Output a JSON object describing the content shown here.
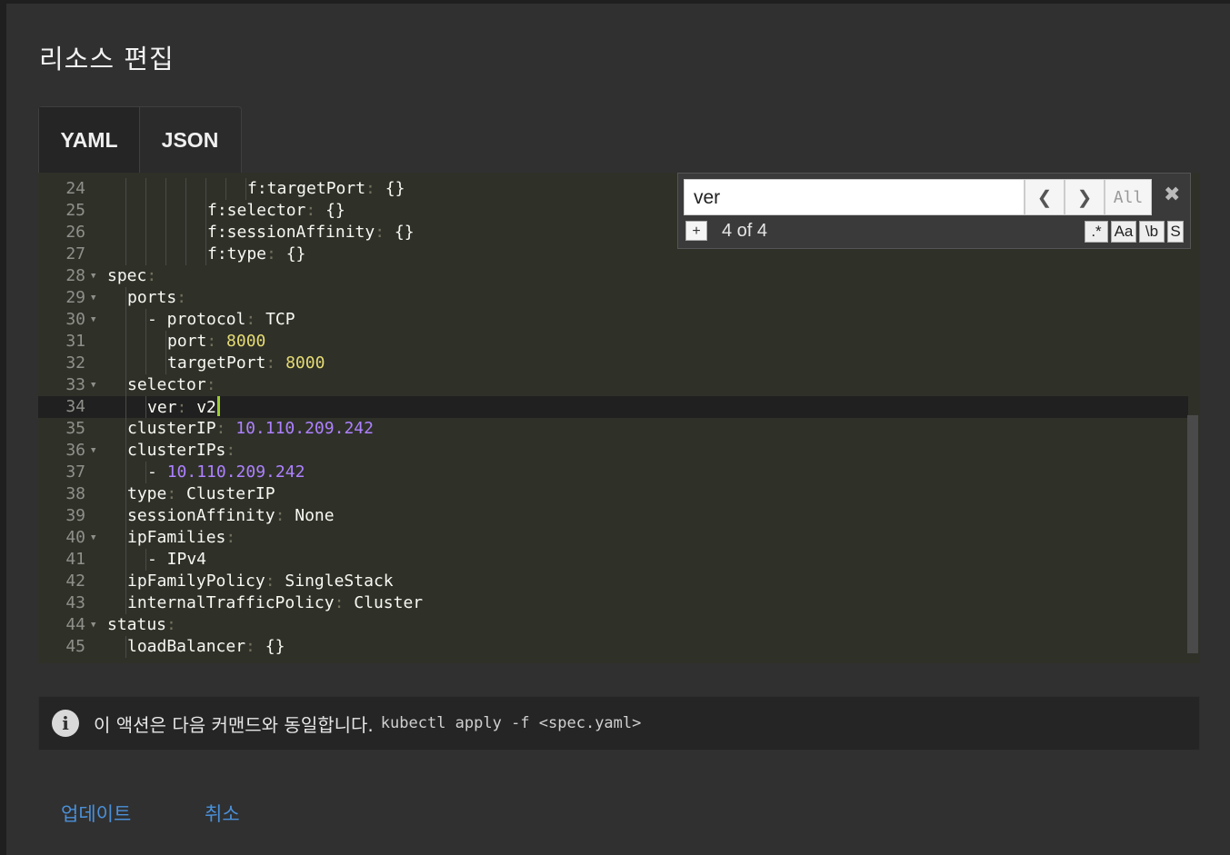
{
  "dialog": {
    "title": "리소스 편집",
    "tabs": [
      "YAML",
      "JSON"
    ],
    "active_tab": "YAML"
  },
  "editor": {
    "lines": [
      {
        "n": "24",
        "indent": 7,
        "parts": [
          [
            "k",
            "f:targetPort"
          ],
          [
            "p",
            ": "
          ],
          [
            "k",
            "{}"
          ]
        ]
      },
      {
        "n": "25",
        "indent": 5,
        "parts": [
          [
            "k",
            "f:selector"
          ],
          [
            "p",
            ": "
          ],
          [
            "k",
            "{}"
          ]
        ]
      },
      {
        "n": "26",
        "indent": 5,
        "parts": [
          [
            "k",
            "f:sessionAffinity"
          ],
          [
            "p",
            ": "
          ],
          [
            "k",
            "{}"
          ]
        ]
      },
      {
        "n": "27",
        "indent": 5,
        "parts": [
          [
            "k",
            "f:type"
          ],
          [
            "p",
            ": "
          ],
          [
            "k",
            "{}"
          ]
        ]
      },
      {
        "n": "28",
        "indent": 0,
        "fold": true,
        "parts": [
          [
            "k",
            "spec"
          ],
          [
            "p",
            ":"
          ]
        ]
      },
      {
        "n": "29",
        "indent": 1,
        "fold": true,
        "parts": [
          [
            "k",
            "ports"
          ],
          [
            "p",
            ":"
          ]
        ]
      },
      {
        "n": "30",
        "indent": 2,
        "fold": true,
        "parts": [
          [
            "k",
            "- protocol"
          ],
          [
            "p",
            ": "
          ],
          [
            "k",
            "TCP"
          ]
        ]
      },
      {
        "n": "31",
        "indent": 3,
        "parts": [
          [
            "k",
            "port"
          ],
          [
            "p",
            ": "
          ],
          [
            "s",
            "8000"
          ]
        ]
      },
      {
        "n": "32",
        "indent": 3,
        "parts": [
          [
            "k",
            "targetPort"
          ],
          [
            "p",
            ": "
          ],
          [
            "s",
            "8000"
          ]
        ]
      },
      {
        "n": "33",
        "indent": 1,
        "fold": true,
        "parts": [
          [
            "k",
            "selector"
          ],
          [
            "p",
            ":"
          ]
        ]
      },
      {
        "n": "34",
        "indent": 2,
        "active": true,
        "parts": [
          [
            "k",
            "ver"
          ],
          [
            "p",
            ": "
          ],
          [
            "k",
            "v2"
          ]
        ]
      },
      {
        "n": "35",
        "indent": 1,
        "parts": [
          [
            "k",
            "clusterIP"
          ],
          [
            "p",
            ": "
          ],
          [
            "n",
            "10.110.209.242"
          ]
        ]
      },
      {
        "n": "36",
        "indent": 1,
        "fold": true,
        "parts": [
          [
            "k",
            "clusterIPs"
          ],
          [
            "p",
            ":"
          ]
        ]
      },
      {
        "n": "37",
        "indent": 2,
        "parts": [
          [
            "k",
            "- "
          ],
          [
            "n",
            "10.110.209.242"
          ]
        ]
      },
      {
        "n": "38",
        "indent": 1,
        "parts": [
          [
            "k",
            "type"
          ],
          [
            "p",
            ": "
          ],
          [
            "k",
            "ClusterIP"
          ]
        ]
      },
      {
        "n": "39",
        "indent": 1,
        "parts": [
          [
            "k",
            "sessionAffinity"
          ],
          [
            "p",
            ": "
          ],
          [
            "k",
            "None"
          ]
        ]
      },
      {
        "n": "40",
        "indent": 1,
        "fold": true,
        "parts": [
          [
            "k",
            "ipFamilies"
          ],
          [
            "p",
            ":"
          ]
        ]
      },
      {
        "n": "41",
        "indent": 2,
        "parts": [
          [
            "k",
            "- IPv4"
          ]
        ]
      },
      {
        "n": "42",
        "indent": 1,
        "parts": [
          [
            "k",
            "ipFamilyPolicy"
          ],
          [
            "p",
            ": "
          ],
          [
            "k",
            "SingleStack"
          ]
        ]
      },
      {
        "n": "43",
        "indent": 1,
        "parts": [
          [
            "k",
            "internalTrafficPolicy"
          ],
          [
            "p",
            ": "
          ],
          [
            "k",
            "Cluster"
          ]
        ]
      },
      {
        "n": "44",
        "indent": 0,
        "fold": true,
        "parts": [
          [
            "k",
            "status"
          ],
          [
            "p",
            ":"
          ]
        ]
      },
      {
        "n": "45",
        "indent": 1,
        "parts": [
          [
            "k",
            "loadBalancer"
          ],
          [
            "p",
            ": "
          ],
          [
            "k",
            "{}"
          ]
        ]
      }
    ]
  },
  "search": {
    "query": "ver",
    "prev_icon": "chevron-left-icon",
    "next_icon": "chevron-right-icon",
    "all_label": "All",
    "close_icon": "close-icon",
    "plus_label": "+",
    "count": "4 of 4",
    "options": [
      ".*",
      "Aa",
      "\\b",
      "S"
    ]
  },
  "info": {
    "icon": "info-icon",
    "text": "이 액션은 다음 커맨드와 동일합니다.",
    "command": "kubectl apply -f <spec.yaml>"
  },
  "actions": {
    "update": "업데이트",
    "cancel": "취소"
  },
  "colors": {
    "accent": "#4a90d9",
    "cursor": "#9acd32"
  }
}
